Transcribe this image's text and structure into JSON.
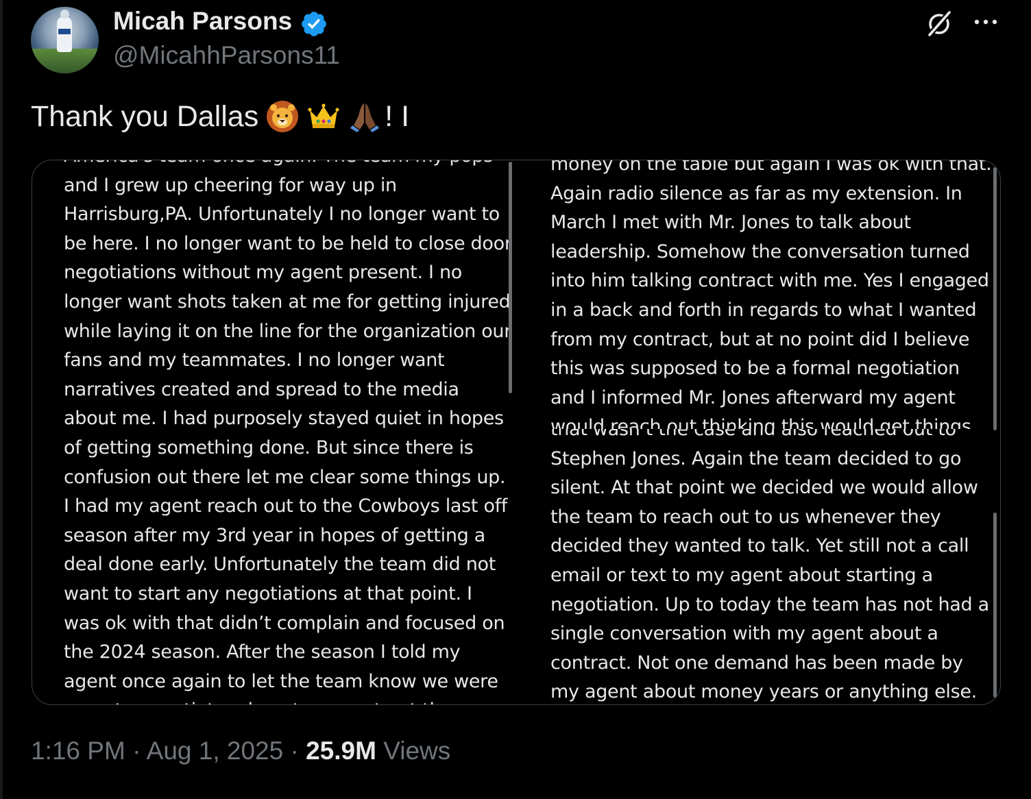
{
  "author": {
    "display_name": "Micah Parsons",
    "handle": "@MicahhParsons11",
    "verified": true,
    "verified_color": "#1d9bf0"
  },
  "header_actions": {
    "grok_icon": "grok-icon",
    "more_icon": "more-horizontal-icon"
  },
  "tweet": {
    "text": "Thank you Dallas",
    "emojis": [
      "lion-face-icon",
      "crown-icon",
      "folded-hands-icon"
    ],
    "suffix": "! I"
  },
  "notes_image": {
    "left_column": {
      "lines": [
        "America's team once again. The team my pops",
        "and I grew up cheering for way up in",
        "Harrisburg,PA. Unfortunately I no longer want to",
        "be here. I no longer want to be held to close door",
        "negotiations without my agent present. I no",
        "longer want shots taken at me for getting injured",
        "while laying it on the line for the organization our",
        "fans and my teammates. I no longer want",
        "narratives created and spread to the media",
        "about me. I had purposely stayed quiet in hopes",
        "of getting something done. But since there is",
        "confusion out there let me clear some things up.",
        "I had my agent reach out to the Cowboys last off",
        "season after my 3rd year in hopes of getting a",
        "deal done early. Unfortunately the team did not",
        "want to start any negotiations at that point. I",
        "was ok with that didn’t complain and focused on",
        "the 2024 season. After the season I told my",
        "agent once again to let the team know we were",
        "open to negotiate a long term contract then."
      ]
    },
    "right_top": {
      "lines": [
        "money on the table but again I was ok with that.",
        "Again radio silence as far as my extension. In",
        "March I met with Mr. Jones to talk about",
        "leadership. Somehow the conversation turned",
        "into him talking contract with me. Yes I engaged",
        "in a back and forth in regards to what I wanted",
        "from my contract, but at no point did I believe",
        "this was supposed to be a formal negotiation",
        "and I informed Mr. Jones afterward my agent",
        "would reach out thinking this would get things"
      ]
    },
    "right_bottom": {
      "lines": [
        "that wasn’t the case and also reached out to",
        "Stephen Jones. Again the team decided to go",
        "silent. At that point we decided we would allow",
        "the team to reach out to us whenever they",
        "decided they wanted to talk. Yet still not a call",
        "email or text to my agent about starting a",
        "negotiation. Up to today the team has not had a",
        "single conversation with my agent about a",
        "contract. Not one demand has been made by",
        "my agent about money years or anything else."
      ]
    }
  },
  "meta": {
    "time": "1:16 PM",
    "separator": " · ",
    "date": "Aug 1, 2025",
    "views_count": "25.9M",
    "views_label": " Views"
  }
}
